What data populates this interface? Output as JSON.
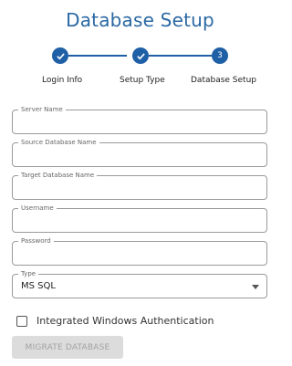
{
  "title": "Database Setup",
  "steps": [
    {
      "label": "Login Info",
      "state": "complete",
      "icon": "check-icon"
    },
    {
      "label": "Setup Type",
      "state": "complete",
      "icon": "check-icon"
    },
    {
      "label": "Database Setup",
      "state": "active",
      "number": "3"
    }
  ],
  "fields": {
    "server_name": {
      "label": "Server Name",
      "value": ""
    },
    "source_db": {
      "label": "Source Database Name",
      "value": ""
    },
    "target_db": {
      "label": "Target Database Name",
      "value": ""
    },
    "username": {
      "label": "Username",
      "value": ""
    },
    "password": {
      "label": "Password",
      "value": ""
    },
    "type": {
      "label": "Type",
      "value": "MS SQL"
    }
  },
  "checkbox": {
    "label": "Integrated Windows Authentication",
    "checked": false
  },
  "button": {
    "label": "MIGRATE DATABASE",
    "disabled": true
  },
  "colors": {
    "accent": "#1f5fa6",
    "title": "#2a68a3",
    "button_disabled_bg": "#dcdcdc"
  }
}
